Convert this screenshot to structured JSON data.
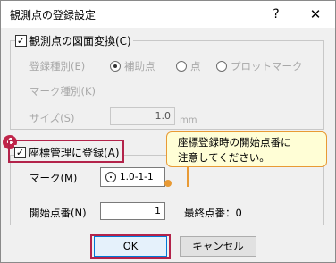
{
  "window": {
    "title": "観測点の登録設定",
    "help_glyph": "?",
    "close_glyph": "✕"
  },
  "section1": {
    "checkbox_label": "観測点の図面変換(C)",
    "checked": true,
    "type_label": "登録種別(E)",
    "type_options": [
      "補助点",
      "点",
      "プロットマーク"
    ],
    "type_selected": "補助点",
    "mark_type_label": "マーク種別(K)",
    "size_label": "サイズ(S)",
    "size_value": "1.0",
    "size_unit": "mm"
  },
  "section2": {
    "checkbox_label": "座標管理に登録(A)",
    "checked": true,
    "badge": "4",
    "mark_label": "マーク(M)",
    "mark_value": "1.0-1-1",
    "start_label": "開始点番(N)",
    "start_value": "1",
    "last_label": "最終点番：0"
  },
  "callout": {
    "line1": "座標登録時の開始点番に",
    "line2": "注意してください。"
  },
  "buttons": {
    "ok": "OK",
    "cancel": "キャンセル"
  },
  "colors": {
    "highlight": "#b3234a",
    "callout_border": "#e89a35",
    "callout_bg": "#fffed6"
  }
}
